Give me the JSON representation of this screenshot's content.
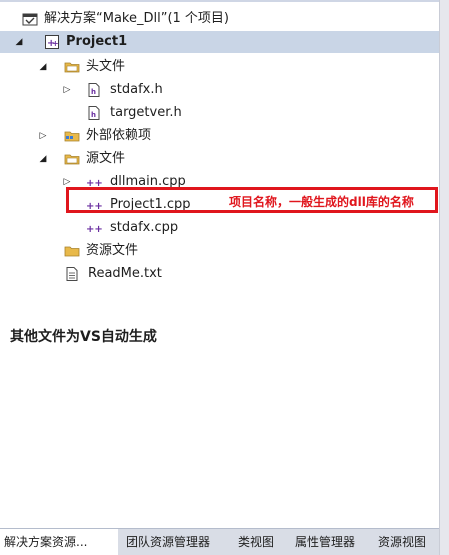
{
  "solution_explorer": {
    "solution_label": "解决方案“Make_Dll”(1 个项目)",
    "project_label": "Project1",
    "header_files_label": "头文件",
    "stdafx_h_label": "stdafx.h",
    "targetver_h_label": "targetver.h",
    "external_deps_label": "外部依赖项",
    "source_files_label": "源文件",
    "dllmain_cpp_label": "dllmain.cpp",
    "project1_cpp_label": "Project1.cpp",
    "stdafx_cpp_label": "stdafx.cpp",
    "resource_files_label": "资源文件",
    "readme_label": "ReadMe.txt"
  },
  "annotations": {
    "project1_note": "项目名称，一般生成的dll库的名称",
    "other_files_note": "其他文件为VS自动生成"
  },
  "tabs": [
    {
      "label": "解决方案资源..."
    },
    {
      "label": "团队资源管理器"
    },
    {
      "label": "类视图"
    },
    {
      "label": "属性管理器"
    },
    {
      "label": "资源视图"
    }
  ],
  "colors": {
    "highlight": "#e0161d",
    "selected_row": "#c9d5e6",
    "folder": "#e8b94a",
    "source_icon": "#6a2fa0"
  },
  "icons": {
    "expanded": "triangle-down-icon",
    "collapsed": "triangle-right-icon",
    "folder": "folder-icon",
    "header_file": "header-file-icon",
    "cpp_file": "cpp-file-icon",
    "text_file": "text-file-icon",
    "solution": "solution-icon",
    "project": "cpp-project-icon"
  }
}
